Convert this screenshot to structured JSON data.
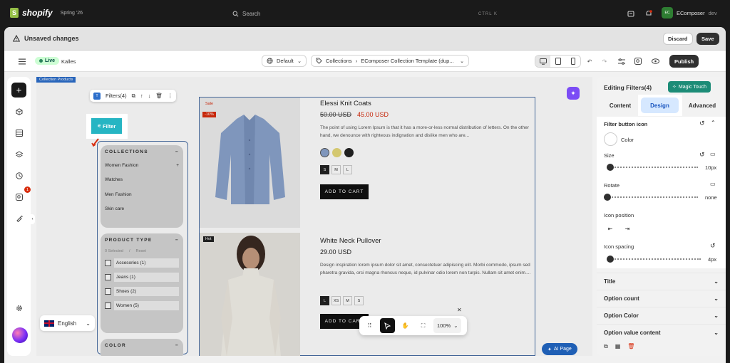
{
  "topbar": {
    "brand": "shopify",
    "season": "Spring '26",
    "search_placeholder": "Search",
    "search_shortcut": "CTRL  K",
    "notification_count": "",
    "store_initials": "EC",
    "store_name": "EComposer",
    "store_role": "dev"
  },
  "unsaved": {
    "title": "Unsaved changes",
    "discard_label": "Discard",
    "save_label": "Save"
  },
  "toolbar": {
    "live_label": "Live",
    "theme_name": "Kalles",
    "default_label": "Default",
    "breadcrumb_root": "Collections",
    "breadcrumb_template": "EComposer Collection Template (dup...",
    "publish_label": "Publish"
  },
  "rail": {
    "badge_count": "1"
  },
  "language": {
    "label": "English"
  },
  "canvas": {
    "section_tag": "Collection Products",
    "selection_label": "Filters(4)",
    "filter_button_label": "Filter",
    "groups": [
      {
        "title": "COLLECTIONS",
        "items": [
          "Women Fashion",
          "Watches",
          "Men Fashion",
          "Skin care"
        ]
      },
      {
        "title": "PRODUCT TYPE",
        "meta_selected": "0 Selected",
        "meta_reset": "Reset",
        "options": [
          "Accesories (1)",
          "Jeans (1)",
          "Shoes (2)",
          "Women (5)"
        ]
      },
      {
        "title": "COLOR"
      }
    ],
    "products": [
      {
        "tag": "Sale",
        "discount": "-10%",
        "name": "Elessi Knit Coats",
        "old_price": "50.00 USD",
        "price": "45.00 USD",
        "description": "The point of using Lorem Ipsum is that it has a more-or-less normal distribution of letters. On the other hand, we denounce with righteous indignation and dislike men who are...",
        "sizes": [
          "S",
          "M",
          "L"
        ],
        "selected_size": "S",
        "cta": "ADD TO CART"
      },
      {
        "tag": "Hot",
        "name": "White Neck Pullover",
        "price": "29.00 USD",
        "description": "Design inspiration lorem ipsum dolor sit amet, consectetuer adipiscing elit. Morbi commodo, ipsum sed pharetra gravida, orci magna rhoncus neque, id pulvinar odio lorem non turpis. Nullam sit amet enim....",
        "sizes": [
          "L",
          "XS",
          "M",
          "S"
        ],
        "selected_size": "L",
        "cta": "ADD TO CART"
      }
    ],
    "zoom": "100%",
    "ai_page_label": "AI Page"
  },
  "panel": {
    "title": "Editing Filters(4)",
    "magic_touch": "Magic Touch",
    "tabs": [
      "Content",
      "Design",
      "Advanced"
    ],
    "active_tab": "Design",
    "section_title": "Filter button icon",
    "color_label": "Color",
    "size_label": "Size",
    "size_value": "10px",
    "rotate_label": "Rotate",
    "rotate_value": "none",
    "icon_position_label": "Icon position",
    "icon_spacing_label": "Icon spacing",
    "icon_spacing_value": "4px",
    "accordions": [
      "Title",
      "Option count",
      "Option Color",
      "Option value content"
    ]
  },
  "colors": {
    "filter_button": "#26b5c3",
    "accent_blue": "#1a56c0",
    "magic_touch": "#1c8c77",
    "sale_tag": "#d82c0d"
  }
}
